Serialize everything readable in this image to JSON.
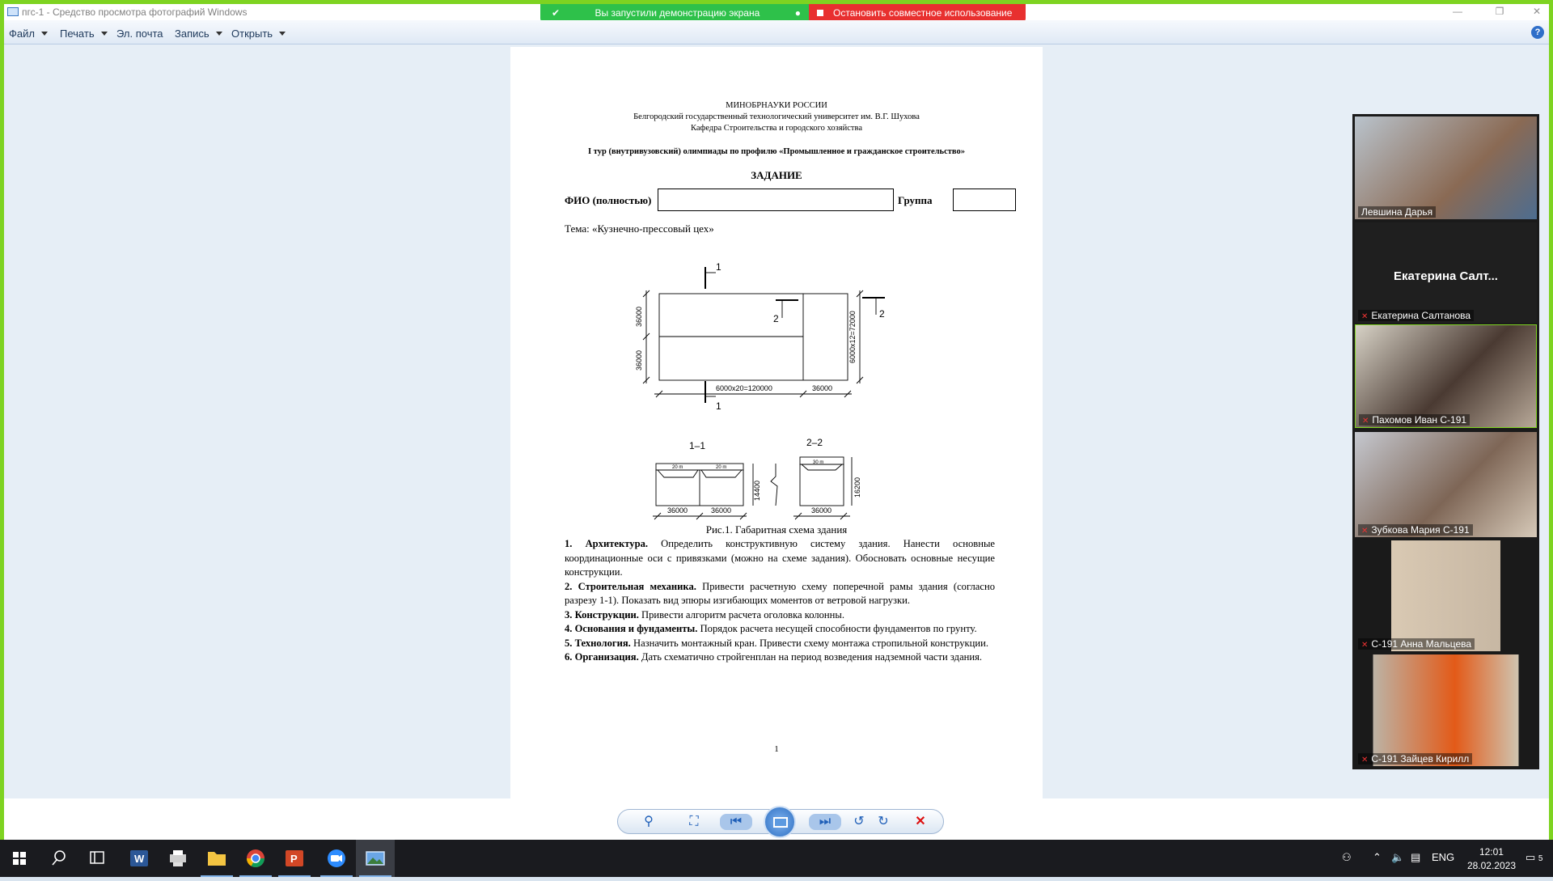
{
  "window": {
    "title": "пгс-1 - Средство просмотра фотографий Windows",
    "minimize": "—",
    "maximize": "❐",
    "close": "✕"
  },
  "share_banner": {
    "message": "Вы запустили демонстрацию экрана",
    "stop": "Остановить совместное использование"
  },
  "menu": {
    "file": "Файл",
    "print": "Печать",
    "email": "Эл. почта",
    "burn": "Запись",
    "open": "Открыть",
    "help": "?"
  },
  "document": {
    "ministry": "МИНОБРНАУКИ РОССИИ",
    "university": "Белгородский государственный технологический университет им. В.Г. Шухова",
    "department": "Кафедра Строительства и городского хозяйства",
    "tour": "I тур (внутривузовский) олимпиады по профилю «Промышленное и гражданское строительство»",
    "task_title": "ЗАДАНИЕ",
    "fio_label": "ФИО (полностью)",
    "group_label": "Группа",
    "topic": "Тема: «Кузнечно-прессовый цех»",
    "figure_caption": "Рис.1. Габаритная схема здания",
    "page_number": "1",
    "drawing": {
      "sec1_top": "1",
      "sec1_bottom": "1",
      "sec2_left": "2",
      "sec2_right": "2",
      "dim_left_top": "36000",
      "dim_left_bottom": "36000",
      "dim_right": "6000х12=72000",
      "dim_bottom_long": "6000х20=120000",
      "dim_bottom_short": "36000",
      "section_1_1": "1–1",
      "section_2_2": "2–2",
      "span_20m_a": "20 m",
      "span_20m_b": "20 m",
      "span_30m": "30 m",
      "height_1_1": "14400",
      "height_2_2": "16200",
      "s11_dim_a": "36000",
      "s11_dim_b": "36000",
      "s22_dim": "36000"
    },
    "tasks": [
      {
        "head": "1. Архитектура.",
        "text": " Определить конструктивную систему здания. Нанести основные координационные оси с привязками (можно на схеме задания). Обосновать основные несущие конструкции."
      },
      {
        "head": "2. Строительная механика.",
        "text": " Привести расчетную схему поперечной рамы здания (согласно разрезу 1-1). Показать вид эпюры изгибающих моментов от ветровой нагрузки."
      },
      {
        "head": "3. Конструкции.",
        "text": " Привести алгоритм расчета оголовка колонны."
      },
      {
        "head": "4. Основания и фундаменты.",
        "text": " Порядок расчета несущей способности фундаментов по грунту."
      },
      {
        "head": "5. Технология.",
        "text": " Назначить монтажный кран. Привести схему монтажа стропильной конструкции."
      },
      {
        "head": "6. Организация.",
        "text": " Дать схематично стройгенплан на период возведения надземной части здания."
      }
    ]
  },
  "participants": [
    {
      "name": "Левшина Дарья"
    },
    {
      "name": "Екатерина Салтанова",
      "big_label": "Екатерина  Салт..."
    },
    {
      "name": "Пахомов Иван С-191"
    },
    {
      "name": "Зубкова Мария С-191"
    },
    {
      "name": "С-191 Анна Мальцева"
    },
    {
      "name": "С-191 Зайцев Кирилл"
    }
  ],
  "tray": {
    "lang": "ENG",
    "time": "12:01",
    "date": "28.02.2023",
    "notifications": "5"
  }
}
